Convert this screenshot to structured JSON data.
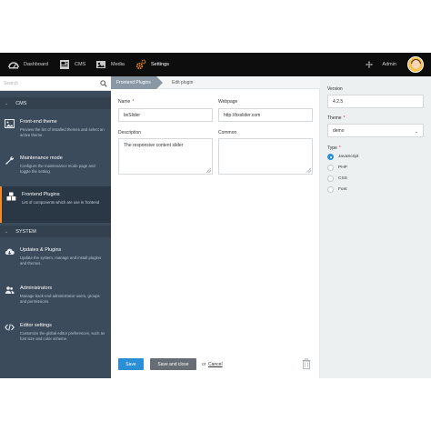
{
  "topbar": {
    "nav": [
      {
        "label": "Dashboard",
        "icon": "dashboard-icon"
      },
      {
        "label": "CMS",
        "icon": "cms-icon"
      },
      {
        "label": "Media",
        "icon": "media-icon"
      },
      {
        "label": "Settings",
        "icon": "settings-icon",
        "active": true
      }
    ],
    "user_label": "Admin"
  },
  "sidebar": {
    "search_placeholder": "Search",
    "sections": [
      {
        "title": "CMS",
        "items": [
          {
            "title": "Front-end theme",
            "desc": "Preview the list of installed themes and select an active theme.",
            "icon": "image-icon"
          },
          {
            "title": "Maintenance mode",
            "desc": "Configure the maintenance mode page and toggle the setting.",
            "icon": "wrench-icon"
          },
          {
            "title": "Frontend Plugins",
            "desc": "List of components which are use in frontend",
            "icon": "cubes-icon",
            "active": true
          }
        ]
      },
      {
        "title": "SYSTEM",
        "items": [
          {
            "title": "Updates & Plugins",
            "desc": "Update the system, manage and install plugins and themes.",
            "icon": "cloud-download-icon"
          },
          {
            "title": "Administrators",
            "desc": "Manage back-end administrator users, groups and permissions.",
            "icon": "users-icon"
          },
          {
            "title": "Editor settings",
            "desc": "Customize the global editor preferences, such as font size and color scheme.",
            "icon": "code-icon"
          }
        ]
      }
    ]
  },
  "breadcrumb": {
    "parent": "Frontend Plugins",
    "current": "Edit plugin"
  },
  "form": {
    "name_label": "Name",
    "name_value": "bxSlider",
    "webpage_label": "Webpage",
    "webpage_value": "http://bxslider.com",
    "description_label": "Description",
    "description_value": "The responsive content slider",
    "common_label": "Common",
    "common_value": ""
  },
  "footer": {
    "save_label": "Save",
    "save_close_label": "Save and close",
    "or_text": "or",
    "cancel_label": "Cancel"
  },
  "panel": {
    "version_label": "Version",
    "version_value": "4.2.5",
    "theme_label": "Theme",
    "theme_value": "demo",
    "type_label": "Type",
    "types": [
      {
        "label": "JavaScript",
        "checked": true
      },
      {
        "label": "PHP",
        "checked": false
      },
      {
        "label": "CSS",
        "checked": false
      },
      {
        "label": "Font",
        "checked": false
      }
    ]
  },
  "colors": {
    "accent": "#f28c28",
    "primary_button": "#2b8fd6",
    "sidebar_bg": "#3b4b5c",
    "topbar_bg": "#0d0d0d"
  }
}
